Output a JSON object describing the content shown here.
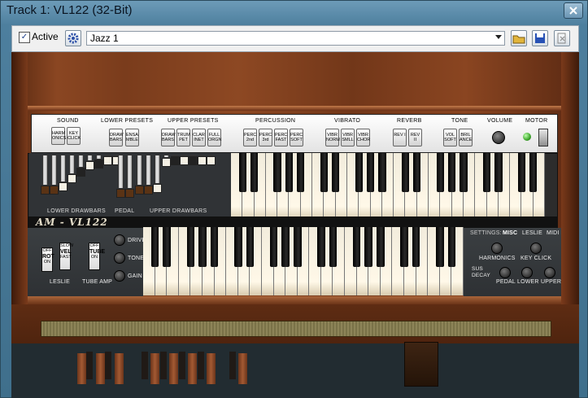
{
  "window": {
    "title": "Track 1: VL122 (32-Bit)"
  },
  "toolbar": {
    "active_label": "Active",
    "active_checked": "✓",
    "preset_value": "Jazz 1"
  },
  "organ": {
    "logo": "AM - VL122",
    "panel": {
      "sound": {
        "label": "SOUND",
        "buttons": [
          "HARM ONICS",
          "KEY CLICK"
        ]
      },
      "lower_presets": {
        "label": "LOWER  PRESETS",
        "buttons": [
          "DRAW BARS",
          "ENSA MBLE"
        ]
      },
      "upper_presets": {
        "label": "UPPER  PRESETS",
        "buttons": [
          "DRAW BARS",
          "TRUM PET",
          "CLAR INET",
          "FULL ORGN"
        ]
      },
      "percussion": {
        "label": "PERCUSSION",
        "buttons": [
          "PERC 2nd",
          "PERC 3rd",
          "PERC FAST",
          "PERC SOFT"
        ]
      },
      "vibrato": {
        "label": "VIBRATO",
        "buttons": [
          "VIBR NORM",
          "VIBR SMLL",
          "VIBR CHOR"
        ]
      },
      "reverb": {
        "label": "REVERB",
        "buttons": [
          "REV I",
          "REV II"
        ]
      },
      "tone": {
        "label": "TONE",
        "buttons": [
          "VOL SOFT",
          "BRIL ANCE"
        ]
      },
      "volume": {
        "label": "VOLUME"
      },
      "motor": {
        "label": "MOTOR"
      }
    },
    "drawbars": {
      "lower_label": "LOWER  DRAWBARS",
      "pedal_label": "PEDAL",
      "upper_label": "UPPER  DRAWBARS"
    },
    "left_controls": {
      "rot": {
        "top": "OFF",
        "main": "ROT",
        "bottom": "ON"
      },
      "vel": {
        "top": "SLOW",
        "main": "VEL",
        "bottom": "FAST"
      },
      "tube": {
        "top": "OFF",
        "main": "TUBE",
        "bottom": "ON"
      },
      "leslie_label": "LESLIE",
      "tube_amp_label": "TUBE AMP",
      "drive_label": "DRIVE",
      "tone_label": "TONE",
      "gain_label": "GAIN"
    },
    "settings": {
      "label": "SETTINGS:",
      "tabs": [
        "MISC",
        "LESLIE",
        "MIDI"
      ],
      "harmonics_label": "HARMONICS",
      "key_click_label": "KEY CLICK",
      "sus_decay_label": "SUS DECAY",
      "pedal_label": "PEDAL",
      "lower_label": "LOWER",
      "upper_label": "UPPER"
    }
  }
}
